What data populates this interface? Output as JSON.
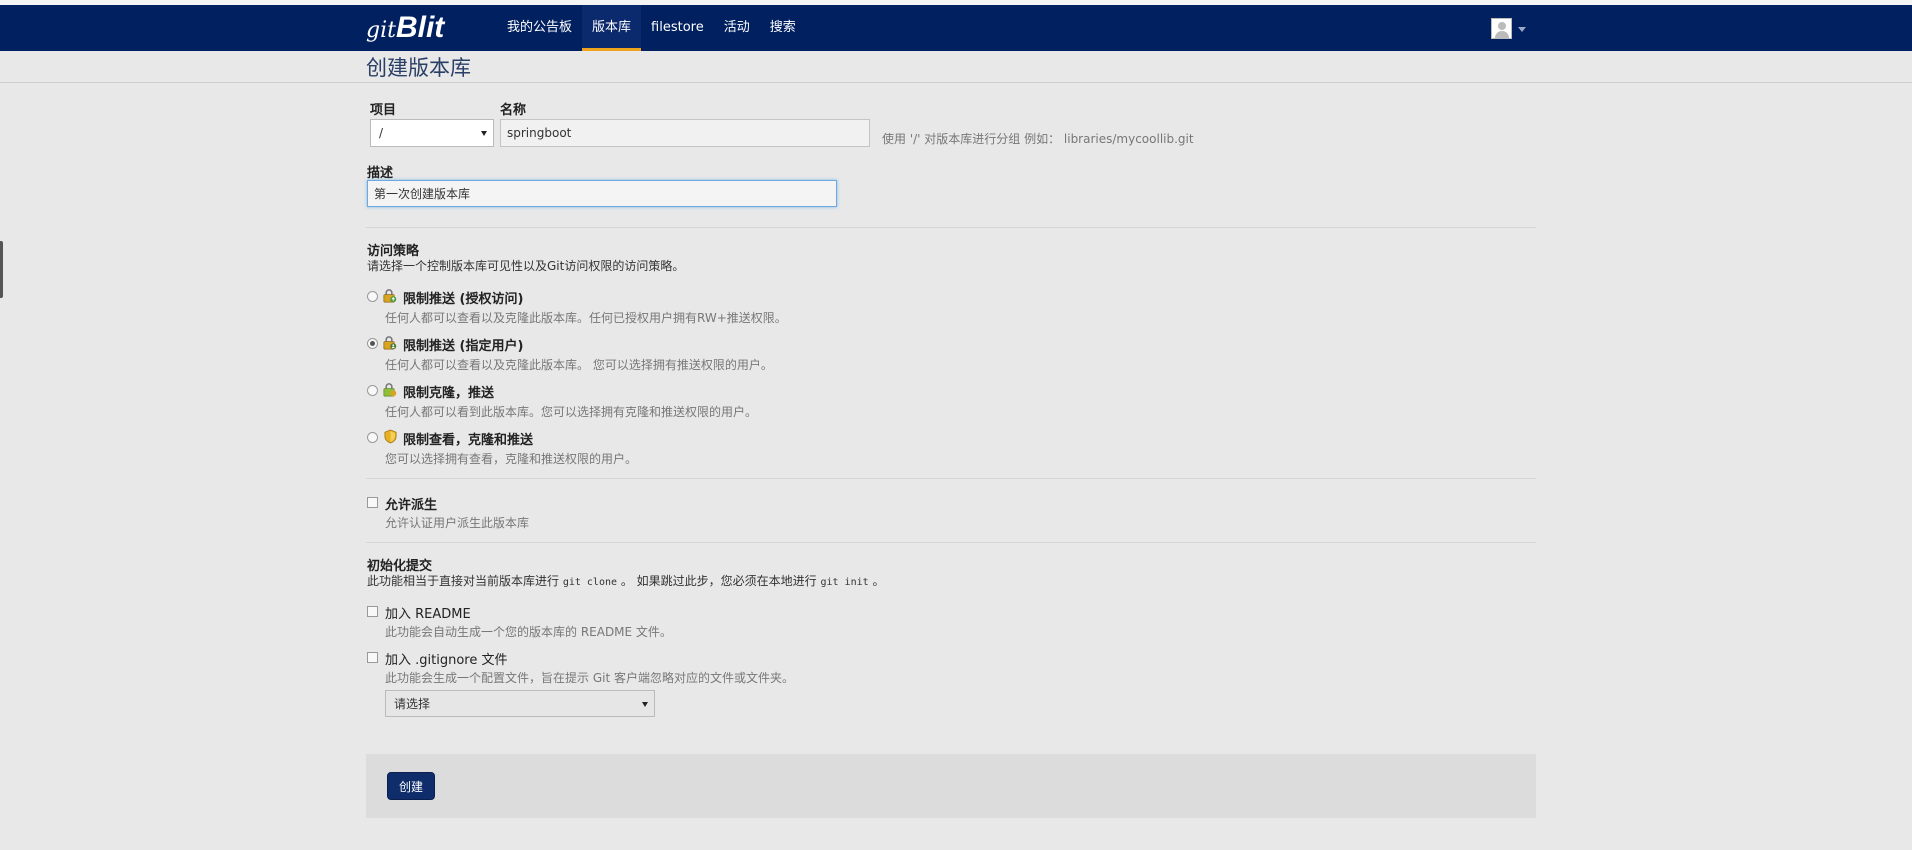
{
  "app": {
    "brand_prefix": "git",
    "brand_name": "Blit"
  },
  "nav": {
    "items": [
      {
        "label": "我的公告板"
      },
      {
        "label": "版本库",
        "active": true
      },
      {
        "label": "filestore"
      },
      {
        "label": "活动"
      },
      {
        "label": "搜索"
      }
    ]
  },
  "page": {
    "title": "创建版本库"
  },
  "form": {
    "project_label": "项目",
    "project_value": "/",
    "name_label": "名称",
    "name_value": "springboot",
    "name_hint": "使用 '/' 对版本库进行分组 例如： libraries/mycoollib.git",
    "description_label": "描述",
    "description_value": "第一次创建版本库"
  },
  "access": {
    "title": "访问策略",
    "description": "请选择一个控制版本库可见性以及Git访问权限的访问策略。",
    "options": [
      {
        "title": "限制推送 (授权访问)",
        "desc": "任何人都可以查看以及克隆此版本库。任何已授权用户拥有RW+推送权限。",
        "checked": false,
        "icon": "lock-push-icon"
      },
      {
        "title": "限制推送 (指定用户)",
        "desc": "任何人都可以查看以及克隆此版本库。 您可以选择拥有推送权限的用户。",
        "checked": true,
        "icon": "lock-push-user-icon"
      },
      {
        "title": "限制克隆，推送",
        "desc": "任何人都可以看到此版本库。您可以选择拥有克隆和推送权限的用户。",
        "checked": false,
        "icon": "lock-clone-icon"
      },
      {
        "title": "限制查看，克隆和推送",
        "desc": "您可以选择拥有查看，克隆和推送权限的用户。",
        "checked": false,
        "icon": "shield-icon"
      }
    ]
  },
  "fork": {
    "title": "允许派生",
    "desc": "允许认证用户派生此版本库"
  },
  "init": {
    "title": "初始化提交",
    "desc_pre": "此功能相当于直接对当前版本库进行 ",
    "desc_code1": "git clone",
    "desc_mid": " 。 如果跳过此步，您必须在本地进行 ",
    "desc_code2": "git init",
    "desc_post": " 。",
    "readme_title": "加入 README",
    "readme_desc": "此功能会自动生成一个您的版本库的 README 文件。",
    "gitignore_title": "加入 .gitignore 文件",
    "gitignore_desc": "此功能会生成一个配置文件，旨在提示 Git 客户端忽略对应的文件或文件夹。",
    "gitignore_select": "请选择"
  },
  "actions": {
    "create_label": "创建"
  },
  "colors": {
    "navbar": "#002060",
    "accent": "#f0a31c",
    "button": "#0f2c6b"
  }
}
